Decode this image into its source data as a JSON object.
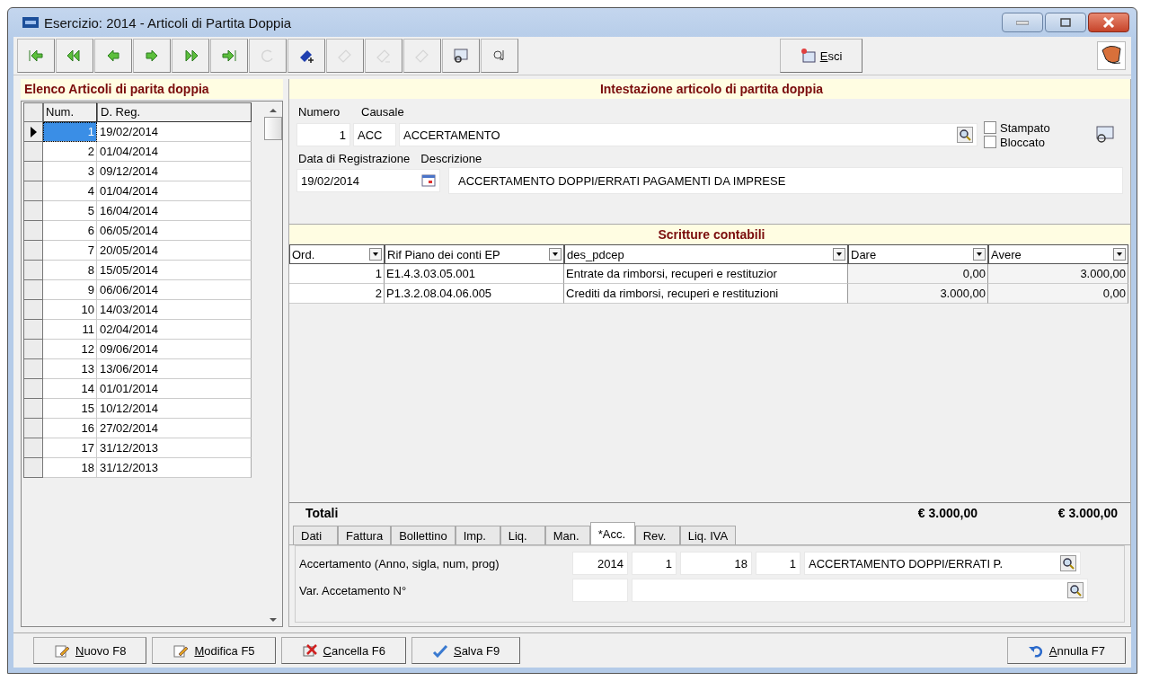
{
  "window": {
    "title": "Esercizio: 2014 - Articoli di Partita Doppia"
  },
  "toolbar": {
    "buttons": [
      {
        "kind": "first",
        "disabled": false
      },
      {
        "kind": "prev-page",
        "disabled": false
      },
      {
        "kind": "prev",
        "disabled": false
      },
      {
        "kind": "next",
        "disabled": false
      },
      {
        "kind": "next-page",
        "disabled": false
      },
      {
        "kind": "last",
        "disabled": false
      },
      {
        "kind": "refresh",
        "disabled": true
      },
      {
        "kind": "new",
        "disabled": false
      },
      {
        "kind": "edit",
        "disabled": true
      },
      {
        "kind": "remove",
        "disabled": true
      },
      {
        "kind": "erase",
        "disabled": true
      },
      {
        "kind": "preview",
        "disabled": false
      },
      {
        "kind": "find",
        "disabled": false
      }
    ],
    "exit": {
      "accel": "E",
      "rest": "sci"
    }
  },
  "list": {
    "title": "Elenco Articoli di parita doppia",
    "columns": [
      "Num.",
      "D. Reg."
    ],
    "rows": [
      {
        "num": "1",
        "date": "19/02/2014",
        "selected": true
      },
      {
        "num": "2",
        "date": "01/04/2014",
        "selected": false
      },
      {
        "num": "3",
        "date": "09/12/2014",
        "selected": false
      },
      {
        "num": "4",
        "date": "01/04/2014",
        "selected": false
      },
      {
        "num": "5",
        "date": "16/04/2014",
        "selected": false
      },
      {
        "num": "6",
        "date": "06/05/2014",
        "selected": false
      },
      {
        "num": "7",
        "date": "20/05/2014",
        "selected": false
      },
      {
        "num": "8",
        "date": "15/05/2014",
        "selected": false
      },
      {
        "num": "9",
        "date": "06/06/2014",
        "selected": false
      },
      {
        "num": "10",
        "date": "14/03/2014",
        "selected": false
      },
      {
        "num": "11",
        "date": "02/04/2014",
        "selected": false
      },
      {
        "num": "12",
        "date": "09/06/2014",
        "selected": false
      },
      {
        "num": "13",
        "date": "13/06/2014",
        "selected": false
      },
      {
        "num": "14",
        "date": "01/01/2014",
        "selected": false
      },
      {
        "num": "15",
        "date": "10/12/2014",
        "selected": false
      },
      {
        "num": "16",
        "date": "27/02/2014",
        "selected": false
      },
      {
        "num": "17",
        "date": "31/12/2013",
        "selected": false
      },
      {
        "num": "18",
        "date": "31/12/2013",
        "selected": false
      }
    ]
  },
  "header": {
    "title": "Intestazione articolo di partita doppia",
    "numero_label": "Numero",
    "causale_label": "Causale",
    "numero": "1",
    "causale_code": "ACC",
    "causale_desc": "ACCERTAMENTO",
    "checks": [
      {
        "label": "Stampato",
        "checked": false
      },
      {
        "label": "Bloccato",
        "checked": false
      }
    ],
    "date_label": "Data di Registrazione",
    "desc_label": "Descrizione",
    "date": "19/02/2014",
    "descrizione": "ACCERTAMENTO DOPPI/ERRATI PAGAMENTI DA IMPRESE"
  },
  "entries": {
    "title": "Scritture contabili",
    "columns": [
      "Ord.",
      "Rif Piano dei conti EP",
      "des_pdcep",
      "Dare",
      "Avere"
    ],
    "rows": [
      [
        "1",
        "E1.4.3.03.05.001",
        "Entrate da rimborsi, recuperi e restituzior",
        "0,00",
        "3.000,00"
      ],
      [
        "2",
        "P1.3.2.08.04.06.005",
        "Crediti da rimborsi, recuperi e restituzioni",
        "3.000,00",
        "0,00"
      ]
    ],
    "totals_label": "Totali",
    "total_dare": "€ 3.000,00",
    "total_avere": "€ 3.000,00"
  },
  "tabs": [
    {
      "label": "Dati",
      "selected": false
    },
    {
      "label": "Fattura",
      "selected": false
    },
    {
      "label": "Bollettino",
      "selected": false
    },
    {
      "label": "Imp.",
      "selected": false
    },
    {
      "label": "Liq.",
      "selected": false
    },
    {
      "label": "Man.",
      "selected": false
    },
    {
      "label": "*Acc.",
      "selected": true
    },
    {
      "label": "Rev.",
      "selected": false
    },
    {
      "label": "Liq. IVA",
      "selected": false
    }
  ],
  "tab_content": {
    "acc_label": "Accertamento (Anno, sigla, num, prog)",
    "acc_fields": [
      "2014",
      "1",
      "18",
      "1"
    ],
    "acc_desc": "ACCERTAMENTO DOPPI/ERRATI P.",
    "var_label": "Var. Accetamento N°"
  },
  "buttons": [
    {
      "kind": "new",
      "accel": "N",
      "rest": "uovo F8"
    },
    {
      "kind": "edit",
      "accel": "M",
      "rest": "odifica F5"
    },
    {
      "kind": "delete",
      "accel": "C",
      "rest": "ancella F6"
    },
    {
      "kind": "save",
      "accel": "S",
      "rest": "alva F9"
    },
    {
      "kind": "undo",
      "accel": "A",
      "rest": "nnulla F7"
    }
  ]
}
